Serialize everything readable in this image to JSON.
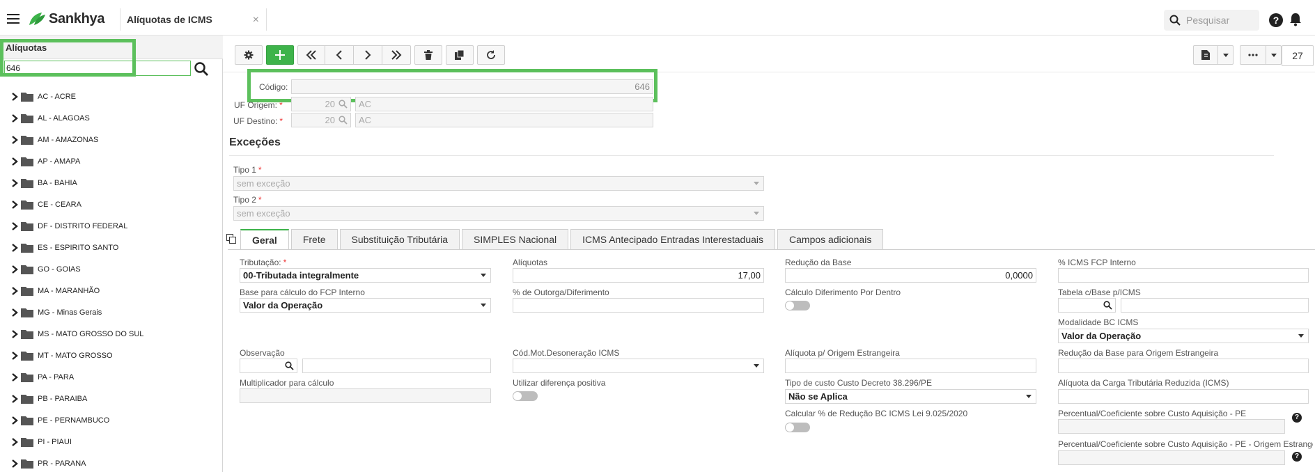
{
  "header": {
    "brand": "Sankhya",
    "tab_title": "Alíquotas de ICMS",
    "tab_close": "×",
    "search_placeholder": "Pesquisar",
    "help": "?"
  },
  "left_panel": {
    "title": "Alíquotas",
    "filter_value": "646",
    "tree": [
      "AC - ACRE",
      "AL - ALAGOAS",
      "AM - AMAZONAS",
      "AP - AMAPA",
      "BA - BAHIA",
      "CE - CEARA",
      "DF - DISTRITO FEDERAL",
      "ES - ESPIRITO SANTO",
      "GO - GOIAS",
      "MA - MARANHÃO",
      "MG - Minas Gerais",
      "MS - MATO GROSSO DO SUL",
      "MT - MATO GROSSO",
      "PA - PARA",
      "PB - PARAIBA",
      "PE - PERNAMBUCO",
      "PI - PIAUI",
      "PR - PARANA"
    ]
  },
  "toolbar": {
    "page_count": "27"
  },
  "form": {
    "codigo_label": "Código:",
    "codigo_value": "646",
    "uf_origem_label": "UF Origem:",
    "uf_origem_code": "20",
    "uf_origem_name": "AC",
    "uf_destino_label": "UF Destino:",
    "uf_destino_code": "20",
    "uf_destino_name": "AC",
    "required_mark": "*"
  },
  "excecoes": {
    "title": "Exceções",
    "tipo1_label": "Tipo 1",
    "tipo1_value": "sem exceção",
    "tipo2_label": "Tipo 2",
    "tipo2_value": "sem exceção"
  },
  "tabs": [
    "Geral",
    "Frete",
    "Substituição Tributária",
    "SIMPLES Nacional",
    "ICMS Antecipado Entradas Interestaduais",
    "Campos adicionais"
  ],
  "geral": {
    "tributacao_label": "Tributação:",
    "tributacao_value": "00-Tributada integralmente",
    "aliquotas_label": "Alíquotas",
    "aliquotas_value": "17,00",
    "reducao_base_label": "Redução da Base",
    "reducao_base_value": "0,0000",
    "icms_fcp_label": "% ICMS FCP Interno",
    "base_fcp_label": "Base para cálculo do FCP Interno",
    "base_fcp_value": "Valor da Operação",
    "outorga_label": "% de Outorga/Diferimento",
    "calc_dif_label": "Cálculo Diferimento Por Dentro",
    "tabela_base_label": "Tabela c/Base p/ICMS",
    "modalidade_label": "Modalidade BC ICMS",
    "modalidade_value": "Valor da Operação",
    "observacao_label": "Observação",
    "cod_mot_label": "Cód.Mot.Desoneração ICMS",
    "aliq_origem_label": "Alíquota p/ Origem Estrangeira",
    "red_base_origem_label": "Redução da Base para Origem Estrangeira",
    "multiplicador_label": "Multiplicador para cálculo",
    "utilizar_dif_label": "Utilizar diferença positiva",
    "tipo_custo_label": "Tipo de custo Custo Decreto 38.296/PE",
    "tipo_custo_value": "Não se Aplica",
    "aliq_carga_label": "Alíquota da Carga Tributária Reduzida (ICMS)",
    "calc_reducao_label": "Calcular % de Redução BC ICMS Lei 9.025/2020",
    "perc_coef_label": "Percentual/Coeficiente sobre Custo Aquisição - PE",
    "perc_coef_origem_label": "Percentual/Coeficiente sobre Custo Aquisição - PE - Origem Estrangeira"
  },
  "colors": {
    "accent": "#3db34a",
    "highlight": "#5cc05c",
    "required": "#ee3333"
  }
}
